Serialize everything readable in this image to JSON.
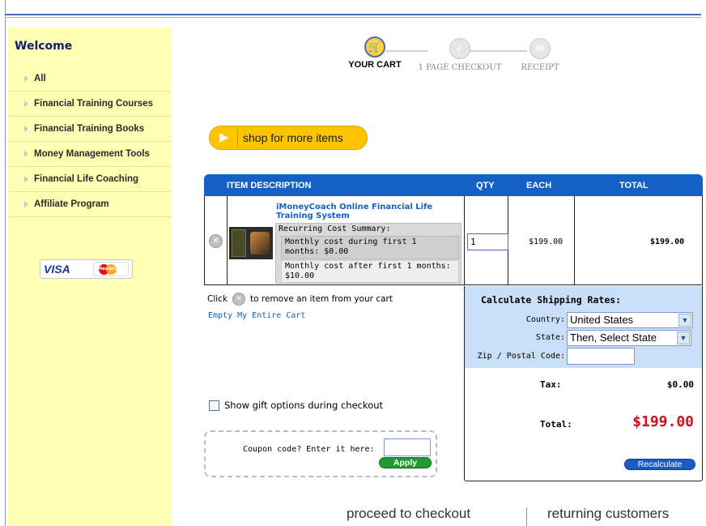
{
  "sidebar": {
    "welcome": "Welcome",
    "items": [
      {
        "label": "All"
      },
      {
        "label": "Financial Training Courses"
      },
      {
        "label": "Financial Training Books"
      },
      {
        "label": "Money Management Tools"
      },
      {
        "label": "Financial Life Coaching"
      },
      {
        "label": "Affiliate Program"
      }
    ],
    "cards": {
      "visa": "VISA",
      "mastercard": "MasterCard"
    }
  },
  "steps": [
    {
      "label": "YOUR CART",
      "icon": "cart-icon",
      "active": true
    },
    {
      "label": "1 PAGE CHECKOUT",
      "icon": "checkmark-icon",
      "active": false
    },
    {
      "label": "RECEIPT",
      "icon": "envelope-icon",
      "active": false
    }
  ],
  "shop_button": {
    "label": "shop for more items"
  },
  "cart": {
    "headers": {
      "description": "ITEM DESCRIPTION",
      "qty": "QTY",
      "each": "EACH",
      "total": "TOTAL"
    },
    "item": {
      "name": "iMoneyCoach Online Financial Life Training System",
      "summary_title": "Recurring Cost Summary:",
      "cost_first": "Monthly cost during first 1 months: $0.00",
      "cost_after": "Monthly cost after first 1 months: $10.00",
      "qty": "1",
      "each": "$199.00",
      "total": "$199.00"
    },
    "remove_note_prefix": "Click",
    "remove_note_suffix": "to remove an item from your cart",
    "empty_cart": "Empty My Entire Cart"
  },
  "shipping": {
    "title": "Calculate Shipping Rates:",
    "country_label": "Country:",
    "country_value": "United States",
    "state_label": "State:",
    "state_value": "Then, Select State",
    "zip_label": "Zip / Postal Code:",
    "zip_value": ""
  },
  "totals": {
    "tax_label": "Tax:",
    "tax_value": "$0.00",
    "total_label": "Total:",
    "total_value": "$199.00",
    "recalculate": "Recalculate"
  },
  "gift": {
    "label": "Show gift options during checkout"
  },
  "coupon": {
    "label": "Coupon code? Enter it here:",
    "value": "",
    "apply": "Apply"
  },
  "footer": {
    "proceed": "proceed to checkout",
    "returning": "returning customers"
  },
  "colors": {
    "accent_blue": "#1560c4",
    "sidebar_bg": "#ffffb3",
    "total_red": "#d0121a",
    "apply_green": "#1e9c2e",
    "shop_yellow": "#ffc400"
  }
}
